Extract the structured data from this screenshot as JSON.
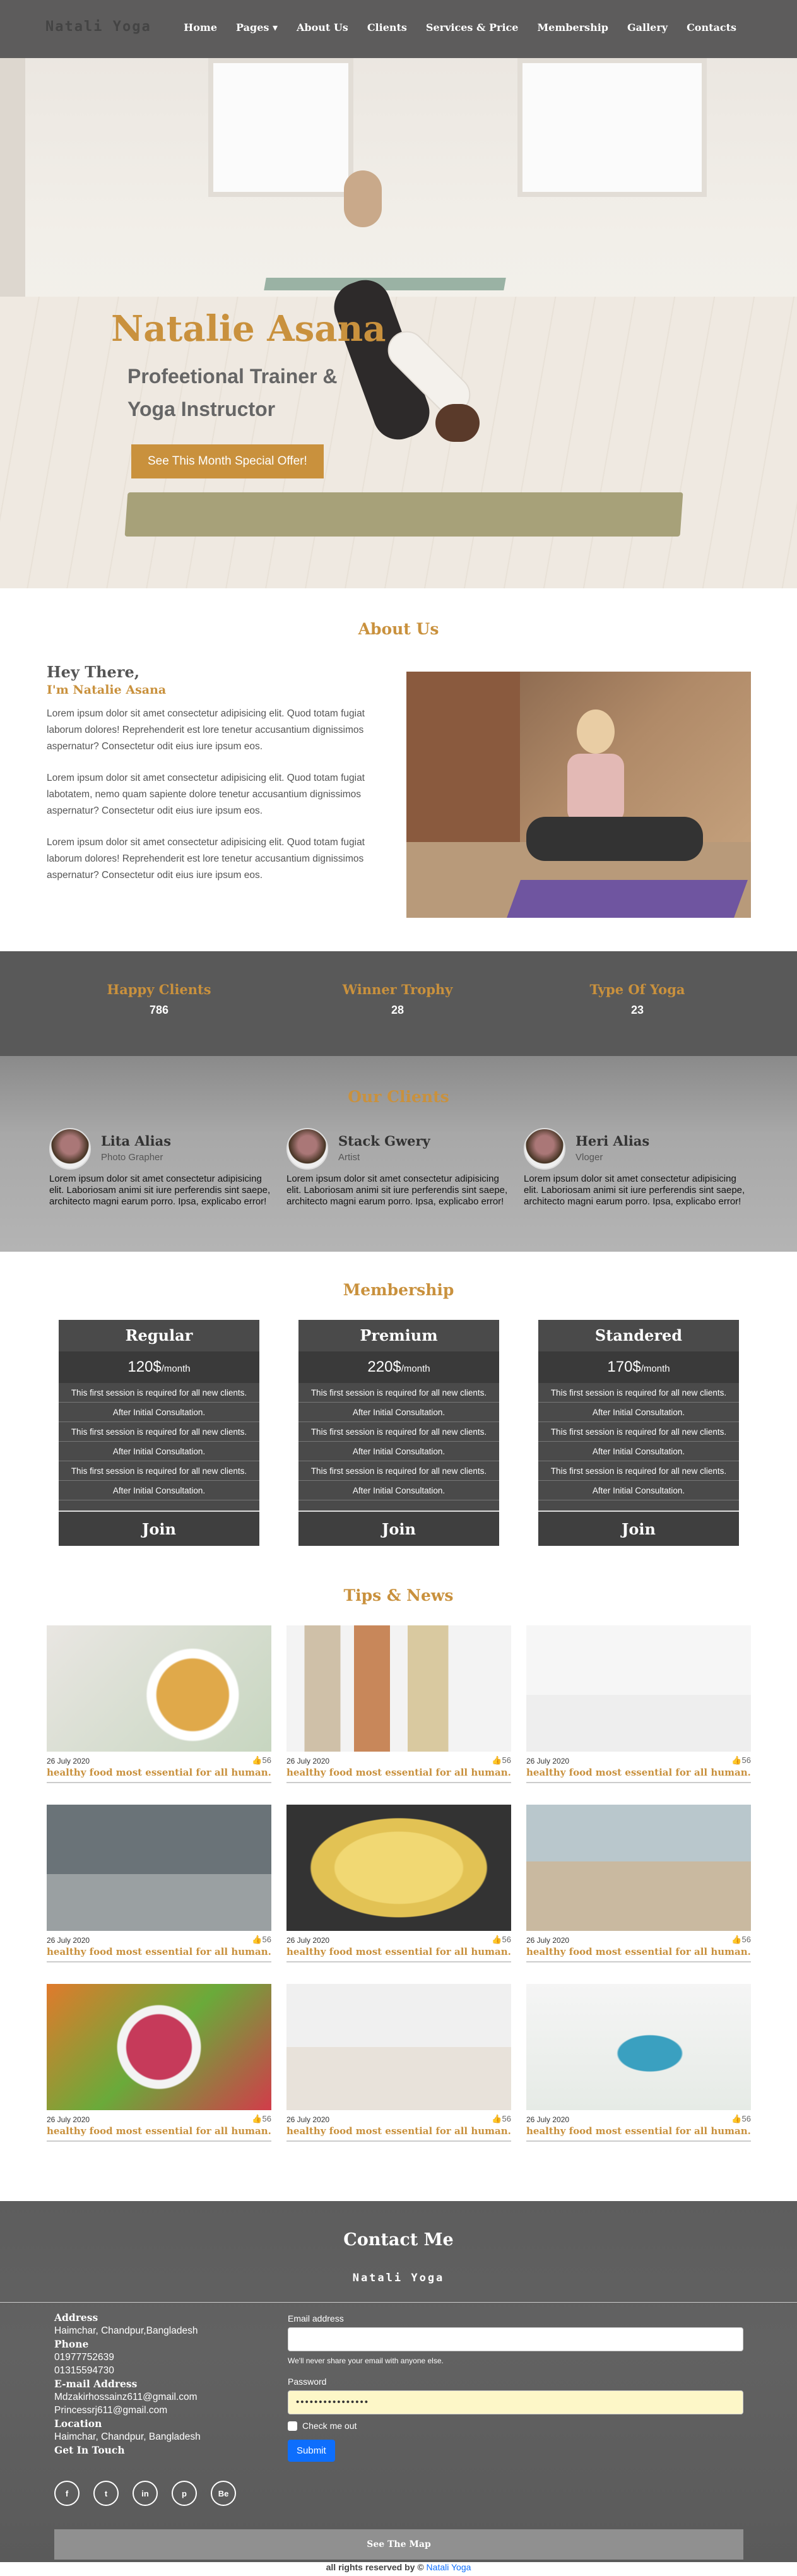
{
  "nav": {
    "brand": "Natali Yoga",
    "items": [
      "Home",
      "Pages ▾",
      "About Us",
      "Clients",
      "Services & Price",
      "Membership",
      "Gallery",
      "Contacts"
    ]
  },
  "hero": {
    "name": "Natalie Asana",
    "subtitle": "Profeetional Trainer & Yoga Instructor",
    "cta": "See This Month Special Offer!"
  },
  "about": {
    "title": "About Us",
    "hey": "Hey There,",
    "im": "I'm Natalie Asana",
    "paragraphs": [
      "Lorem ipsum dolor sit amet consectetur adipisicing elit. Quod totam fugiat laborum dolores! Reprehenderit est lore tenetur accusantium dignissimos aspernatur? Consectetur odit eius iure ipsum eos.",
      "Lorem ipsum dolor sit amet consectetur adipisicing elit. Quod totam fugiat labotatem, nemo quam sapiente dolore tenetur accusantium dignissimos aspernatur? Consectetur odit eius iure ipsum eos.",
      "Lorem ipsum dolor sit amet consectetur adipisicing elit. Quod totam fugiat laborum dolores! Reprehenderit est lore tenetur accusantium dignissimos aspernatur? Consectetur odit eius iure ipsum eos."
    ]
  },
  "stats": [
    {
      "title": "Happy Clients",
      "value": "786"
    },
    {
      "title": "Winner Trophy",
      "value": "28"
    },
    {
      "title": "Type Of Yoga",
      "value": "23"
    }
  ],
  "clients": {
    "title": "Our Clients",
    "items": [
      {
        "name": "Lita Alias",
        "role": "Photo Grapher",
        "text": "Lorem ipsum dolor sit amet consectetur adipisicing elit. Laboriosam animi sit iure perferendis sint saepe, architecto magni earum porro. Ipsa, explicabo error!"
      },
      {
        "name": "Stack Gwery",
        "role": "Artist",
        "text": "Lorem ipsum dolor sit amet consectetur adipisicing elit. Laboriosam animi sit iure perferendis sint saepe, architecto magni earum porro. Ipsa, explicabo error!"
      },
      {
        "name": "Heri Alias",
        "role": "Vloger",
        "text": "Lorem ipsum dolor sit amet consectetur adipisicing elit. Laboriosam animi sit iure perferendis sint saepe, architecto magni earum porro. Ipsa, explicabo error!"
      }
    ]
  },
  "membership": {
    "title": "Membership",
    "plans": [
      {
        "name": "Regular",
        "price": "120$",
        "per": "/month",
        "join": "Join"
      },
      {
        "name": "Premium",
        "price": "220$",
        "per": "/month",
        "join": "Join"
      },
      {
        "name": "Standered",
        "price": "170$",
        "per": "/month",
        "join": "Join"
      }
    ],
    "lines": [
      "This first session is required for all new clients.",
      "After Initial Consultation.",
      "This first session is required for all new clients.",
      "After Initial Consultation.",
      "This first session is required for all new clients.",
      "After Initial Consultation."
    ]
  },
  "news": {
    "title": "Tips & News",
    "date": "26 July 2020",
    "likes": "👍56",
    "headline": "healthy food most essential for all human."
  },
  "contact": {
    "title": "Contact Me",
    "logo": "Natali Yoga",
    "address_label": "Address",
    "address": "Haimchar, Chandpur,Bangladesh",
    "phone_label": "Phone",
    "phone1": "01977752639",
    "phone2": "01315594730",
    "email_label": "E-mail Address",
    "email1": "Mdzakirhossainz611@gmail.com",
    "email2": "Princessrj611@gmail.com",
    "location_label": "Location",
    "location": "Haimchar, Chandpur, Bangladesh",
    "touch_label": "Get In Touch",
    "social": [
      "f",
      "t",
      "in",
      "p",
      "Be"
    ],
    "email_field_label": "Email address",
    "email_help": "We'll never share your email with anyone else.",
    "password_label": "Password",
    "password_value": "••••••••••••••••",
    "check_label": "Check me out",
    "submit": "Submit",
    "map": "See The Map"
  },
  "footer": {
    "text": "all rights reserved by ©",
    "link": "Natali Yoga"
  },
  "colors": {
    "accent": "#c9913d",
    "dark": "#4a4a4a",
    "primary": "#0d6efd"
  }
}
